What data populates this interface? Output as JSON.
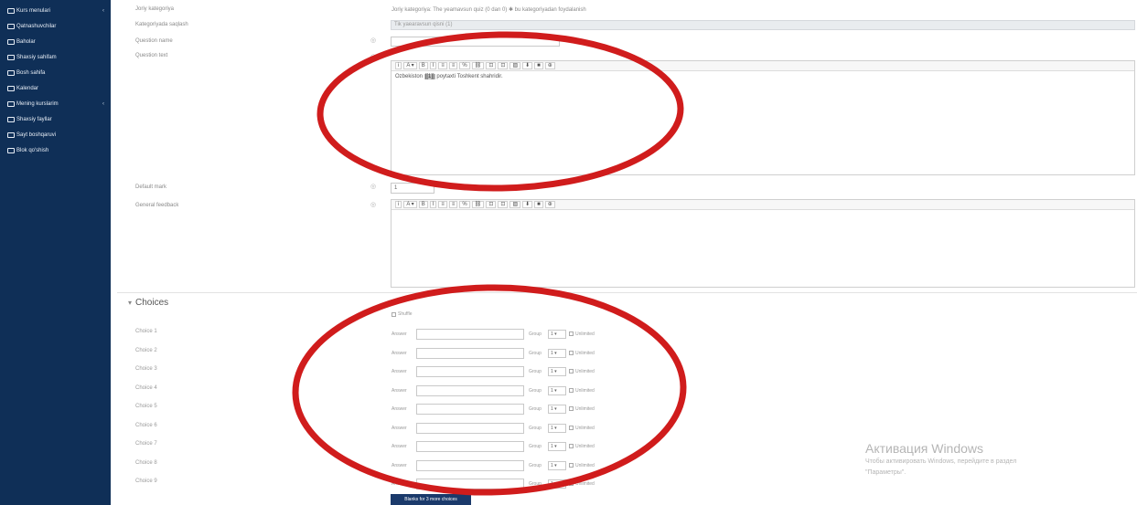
{
  "sidebar": {
    "bg_color": "#0f2f57",
    "items": [
      {
        "label": "Kurs menulari",
        "icon": "folder-icon",
        "has_caret": true
      },
      {
        "label": "Qatnashuvchilar",
        "icon": "users-icon",
        "has_caret": false
      },
      {
        "label": "Baholar",
        "icon": "grades-icon",
        "has_caret": false
      },
      {
        "label": "Shaxsiy sahifam",
        "icon": "dashboard-icon",
        "has_caret": false
      },
      {
        "label": "Bosh sahifa",
        "icon": "home-icon",
        "has_caret": false
      },
      {
        "label": "Kalendar",
        "icon": "calendar-icon",
        "has_caret": false
      },
      {
        "label": "Mening kurslarim",
        "icon": "courses-icon",
        "has_caret": true
      },
      {
        "label": "Shaxsiy fayllar",
        "icon": "files-icon",
        "has_caret": false
      },
      {
        "label": "Sayt boshqaruvi",
        "icon": "gear-icon",
        "has_caret": false
      },
      {
        "label": "Blok qo'shish",
        "icon": "add-block-icon",
        "has_caret": false
      }
    ]
  },
  "form": {
    "category_label": "Joriy kategoriya",
    "category_value": "Joriy kategoriya: The yeamavsun quiz (0 dan 0) ✱ bu kategoriyadan foydalanish",
    "save_in_label": "Kategoriyada saqlash",
    "save_in_value": "Tik yaearavsun qisni (1)",
    "question_name_label": "Question name",
    "question_text_label": "Question text",
    "question_text_prefix": "Ozbekiston",
    "question_text_blank": "[[1]]",
    "question_text_suffix": "poytaxti Toshkent shahridir.",
    "default_mark_label": "Default mark",
    "default_mark_value": "1",
    "general_feedback_label": "General feedback",
    "toolbar_buttons": [
      "i",
      "A ▾",
      "B",
      "I",
      "≡",
      "≡",
      "%",
      "⛓",
      "⊡",
      "⊡",
      "▨",
      "⬇",
      "■",
      "⊕"
    ]
  },
  "choices": {
    "title": "Choices",
    "shuffle_label": "Shuffle",
    "answer_label": "Answer",
    "group_label": "Group",
    "unlimited_label": "Unlimited",
    "items": [
      {
        "label": "Choice 1",
        "group": "1"
      },
      {
        "label": "Choice 2",
        "group": "1"
      },
      {
        "label": "Choice 3",
        "group": "1"
      },
      {
        "label": "Choice 4",
        "group": "1"
      },
      {
        "label": "Choice 5",
        "group": "1"
      },
      {
        "label": "Choice 6",
        "group": "1"
      },
      {
        "label": "Choice 7",
        "group": "1"
      },
      {
        "label": "Choice 8",
        "group": "1"
      },
      {
        "label": "Choice 9",
        "group": "1"
      }
    ],
    "blanks_button": "Blanks for 3 more choices"
  },
  "watermark": {
    "line1": "Активация Windows",
    "line2": "Чтобы активировать Windows, перейдите в раздел",
    "line3": "\"Параметры\"."
  },
  "annotation_color": "#d01c1c"
}
